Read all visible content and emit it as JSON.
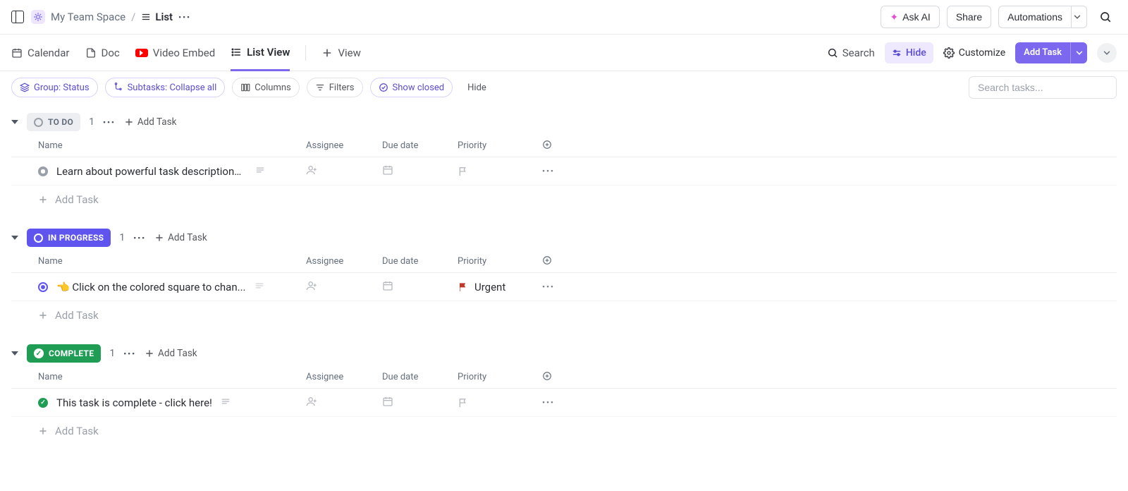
{
  "breadcrumb": {
    "space": "My Team Space",
    "current": "List"
  },
  "topbar": {
    "ask_ai": "Ask AI",
    "share": "Share",
    "automations": "Automations"
  },
  "views": {
    "calendar": "Calendar",
    "doc": "Doc",
    "video": "Video Embed",
    "listview": "List View",
    "add_view": "View"
  },
  "view_actions": {
    "search": "Search",
    "hide": "Hide",
    "customize": "Customize",
    "add_task": "Add Task"
  },
  "chips": {
    "group": "Group: Status",
    "subtasks": "Subtasks: Collapse all",
    "columns": "Columns",
    "filters": "Filters",
    "show_closed": "Show closed",
    "hide": "Hide"
  },
  "search_tasks_placeholder": "Search tasks...",
  "columns": {
    "name": "Name",
    "assignee": "Assignee",
    "due": "Due date",
    "priority": "Priority"
  },
  "labels": {
    "add_task": "Add Task"
  },
  "groups": {
    "todo": {
      "label": "TO DO",
      "count": "1",
      "tasks": [
        {
          "title": "Learn about powerful task descriptions ...",
          "has_desc": true,
          "priority": ""
        }
      ]
    },
    "inprogress": {
      "label": "IN PROGRESS",
      "count": "1",
      "tasks": [
        {
          "title": "👈 Click on the colored square to chan...",
          "has_desc": true,
          "priority": "Urgent"
        }
      ]
    },
    "complete": {
      "label": "COMPLETE",
      "count": "1",
      "tasks": [
        {
          "title": "This task is complete - click here!",
          "has_desc": true,
          "priority": ""
        }
      ]
    }
  }
}
